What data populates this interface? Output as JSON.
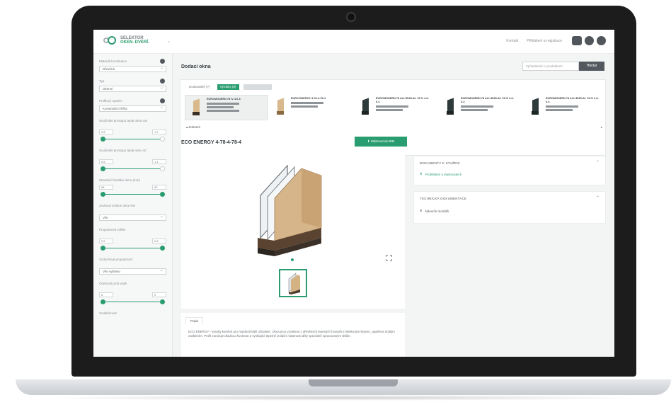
{
  "topbar": {
    "logo_line1": "SELEKTOR",
    "logo_line2": "OKEN. DVERÍ.",
    "links": [
      "Kontakt",
      "Přihlášení a registrace"
    ],
    "icons": [
      "youtube-icon",
      "facebook-icon",
      "user-icon"
    ]
  },
  "sidebar": {
    "filters": [
      {
        "label": "Materiál konstrukce",
        "value": "Dřevěná"
      },
      {
        "label": "Typ",
        "value": "Okenní"
      },
      {
        "label": "Profilový systém",
        "value": "Konstrukční šířka"
      },
      {
        "label": "Součinitel prostupu tepla okna Uw",
        "min": "0.6",
        "max": "1.2"
      },
      {
        "label": "Součinitel prostupu tepla rámu Uf",
        "min": "0.6",
        "max": "1.4"
      },
      {
        "label": "Stavební hloubka rámu (mm)",
        "min": "68",
        "max": "92"
      },
      {
        "label": "Zvuková izolace okna Rw",
        "value": "Vše"
      },
      {
        "label": "Propustnost světla",
        "min": "0.5",
        "max": "0.8"
      },
      {
        "label": "Vzduchová propustnost",
        "value": "Vše vybráno"
      },
      {
        "label": "Odolnost proti vodě",
        "min": "6",
        "max": "9"
      },
      {
        "label": "Vodotěsnost"
      }
    ]
  },
  "main": {
    "title": "Dodací okna",
    "search_placeholder": "Vyhledávání v produktech",
    "search_button": "Hledat",
    "tabs": [
      "Dodavatelé (7)",
      "Výrobky (5)",
      ""
    ],
    "cards": [
      {
        "name": "EUROMODERN 78 IV 4-6-6",
        "selected": true
      },
      {
        "name": "EURO ENERGY 4-78-4-78-4",
        "selected": false
      },
      {
        "name": "EUROMODERN 78 ALU EUR-AL 78 IV 4-6-6-4",
        "selected": false
      },
      {
        "name": "EUROMODERN 78 ALU EUR-AL 78 IV 4-6-6-4",
        "selected": false
      },
      {
        "name": "EUROMODERN 78 ALU EUR-AL 78 IV 4-6-6-4",
        "selected": false
      }
    ],
    "collapse_label": "Zobrazit",
    "detail_title": "ECO ENERGY 4-78-4-78-4",
    "download_button": "Stáhnout do BIM",
    "description_tab": "Popis",
    "description": "ECO ENERGY - vysoký komfort pro nejnáročnější uživatele. Okna jsou vyrobena z dřevěných lepených hranolů s hliníkovým krytem, opatřena trojitým zasklením. Profil zaručuje dlouhou životnost a vynikající tepelně izolační vlastnosti díky speciálně zpracovaným sklům."
  },
  "panels": [
    {
      "title": "DOKUMENTY K STAŽENÍ",
      "item": "Prohlášení o vlastnostech"
    },
    {
      "title": "TECHNICKÁ DOKUMENTACE",
      "item": "Návod k montáži"
    }
  ],
  "colors": {
    "accent": "#2a9d70",
    "dark": "#52585e",
    "background": "#f3f4f4"
  }
}
